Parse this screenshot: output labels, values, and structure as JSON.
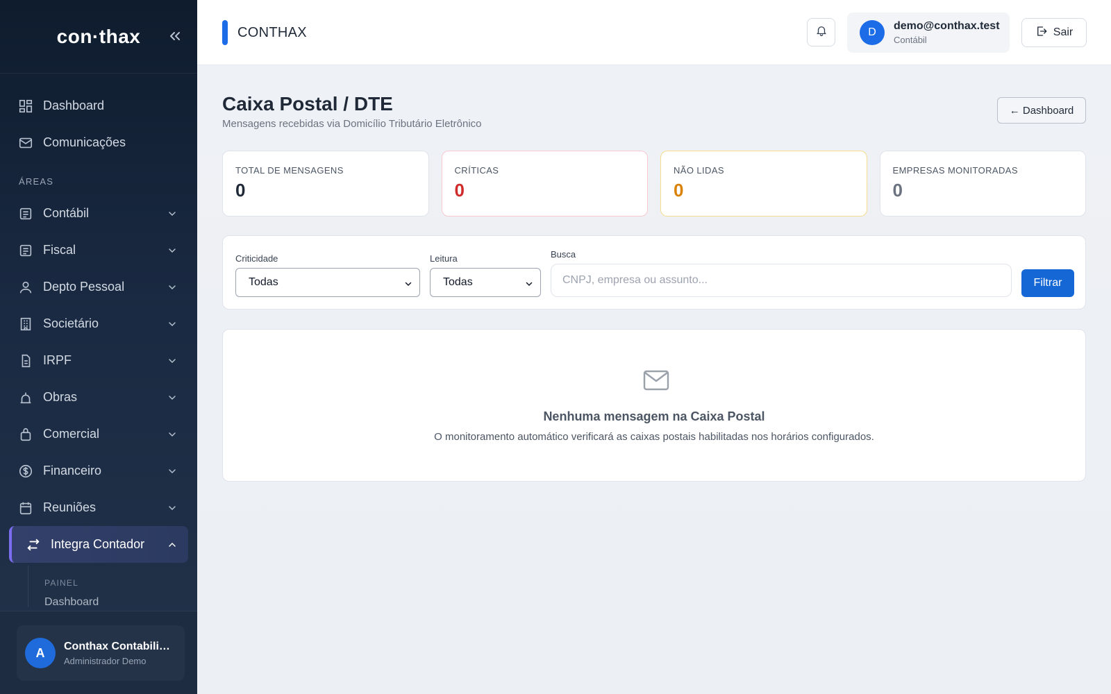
{
  "brand": {
    "logo": "con·thax"
  },
  "sidebar": {
    "top_items": [
      {
        "label": "Dashboard",
        "icon": "grid-icon"
      },
      {
        "label": "Comunicações",
        "icon": "mail-icon"
      }
    ],
    "section_label": "ÁREAS",
    "areas": [
      {
        "label": "Contábil",
        "icon": "ledger-icon"
      },
      {
        "label": "Fiscal",
        "icon": "ledger-icon"
      },
      {
        "label": "Depto Pessoal",
        "icon": "user-icon"
      },
      {
        "label": "Societário",
        "icon": "building-icon"
      },
      {
        "label": "IRPF",
        "icon": "document-icon"
      },
      {
        "label": "Obras",
        "icon": "construction-icon"
      },
      {
        "label": "Comercial",
        "icon": "bag-icon"
      },
      {
        "label": "Financeiro",
        "icon": "dollar-icon"
      },
      {
        "label": "Reuniões",
        "icon": "calendar-icon"
      }
    ],
    "active_item": {
      "label": "Integra Contador",
      "icon": "swap-arrows-icon"
    },
    "submenu": {
      "section": "PAINEL",
      "first_item": "Dashboard"
    },
    "footer_user": {
      "avatar_letter": "A",
      "name": "Conthax Contabilidade",
      "role": "Administrador Demo"
    }
  },
  "topbar": {
    "title": "CONTHAX",
    "account": {
      "avatar_letter": "D",
      "email": "demo@conthax.test",
      "role": "Contábil"
    },
    "logout_label": "Sair"
  },
  "page": {
    "title": "Caixa Postal / DTE",
    "subtitle": "Mensagens recebidas via Domicílio Tributário Eletrônico",
    "back_label": "← Dashboard"
  },
  "stats": [
    {
      "label": "TOTAL DE MENSAGENS",
      "value": "0"
    },
    {
      "label": "CRÍTICAS",
      "value": "0",
      "color": "#d02a2a"
    },
    {
      "label": "NÃO LIDAS",
      "value": "0",
      "color": "#d98206"
    },
    {
      "label": "EMPRESAS MONITORADAS",
      "value": "0"
    }
  ],
  "filters": {
    "criticidade": {
      "label": "Criticidade",
      "value": "Todas"
    },
    "leitura": {
      "label": "Leitura",
      "value": "Todas"
    },
    "busca": {
      "label": "Busca",
      "value": "",
      "placeholder": "CNPJ, empresa ou assunto..."
    },
    "submit_label": "Filtrar"
  },
  "empty_state": {
    "icon": "envelope-icon",
    "title": "Nenhuma mensagem na Caixa Postal",
    "description": "O monitoramento automático verificará as caixas postais habilitadas nos horários configurados."
  },
  "colors": {
    "accent": "#1b6ce6",
    "active_border": "#7c6cf0",
    "primary_button": "#1667d6"
  }
}
